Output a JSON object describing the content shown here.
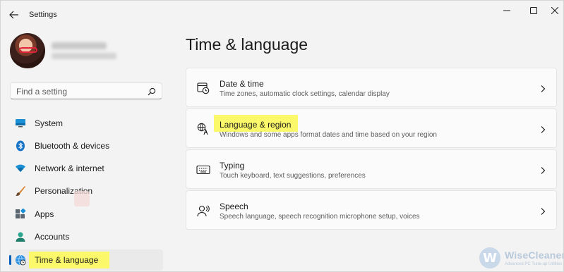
{
  "window": {
    "title": "Settings"
  },
  "search": {
    "placeholder": "Find a setting"
  },
  "sidebar": {
    "items": [
      {
        "label": "System",
        "icon": "system-icon"
      },
      {
        "label": "Bluetooth & devices",
        "icon": "bluetooth-icon"
      },
      {
        "label": "Network & internet",
        "icon": "wifi-icon"
      },
      {
        "label": "Personalization",
        "icon": "brush-icon"
      },
      {
        "label": "Apps",
        "icon": "apps-icon"
      },
      {
        "label": "Accounts",
        "icon": "accounts-icon"
      },
      {
        "label": "Time & language",
        "icon": "globe-clock-icon",
        "selected": true
      }
    ]
  },
  "main": {
    "title": "Time & language",
    "cards": [
      {
        "title": "Date & time",
        "description": "Time zones, automatic clock settings, calendar display",
        "icon": "calendar-clock-icon"
      },
      {
        "title": "Language & region",
        "description": "Windows and some apps format dates and time based on your region",
        "icon": "language-icon"
      },
      {
        "title": "Typing",
        "description": "Touch keyboard, text suggestions, preferences",
        "icon": "keyboard-icon"
      },
      {
        "title": "Speech",
        "description": "Speech language, speech recognition microphone setup, voices",
        "icon": "speech-icon"
      }
    ]
  },
  "watermark": {
    "logo_letter": "W",
    "name": "WiseCleaner",
    "tagline": "Advanced PC Tune-up Utilities"
  },
  "colors": {
    "accent": "#005fb8",
    "highlight": "#fbf96a",
    "background": "#f3f3f3",
    "card": "#fbfbfb"
  }
}
